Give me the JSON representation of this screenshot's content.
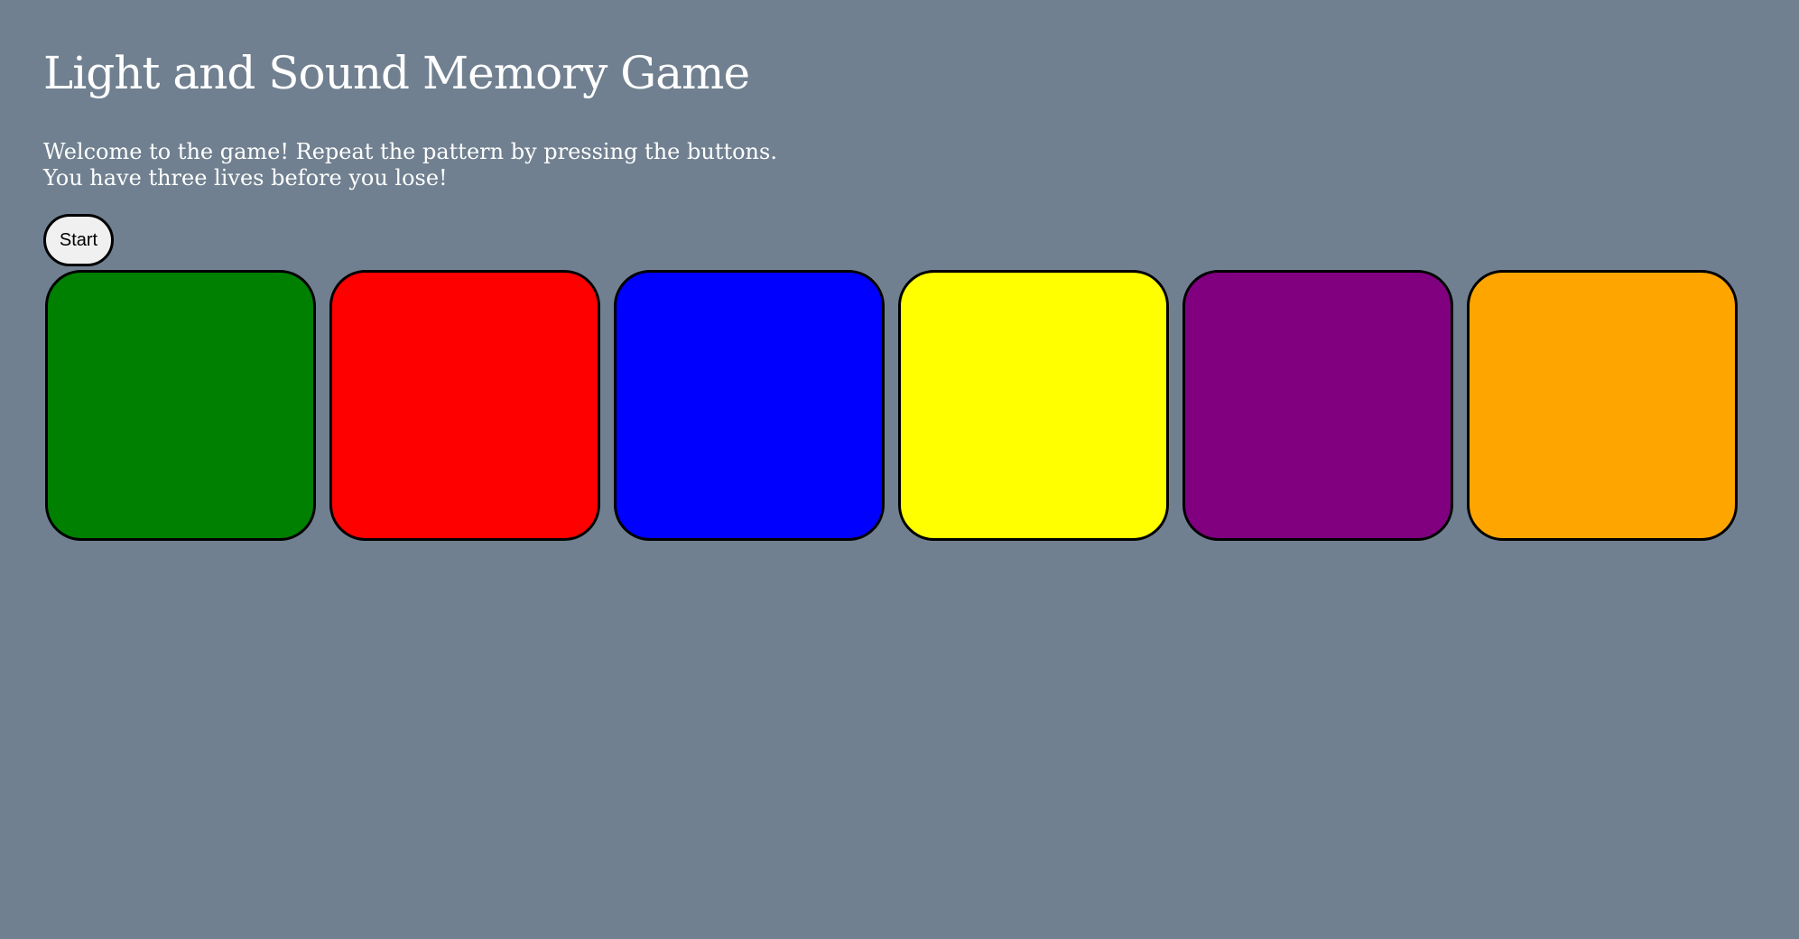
{
  "title": "Light and Sound Memory Game",
  "intro": {
    "line1": "Welcome to the game! Repeat the pattern by pressing the buttons.",
    "line2": "You have three lives before you lose!"
  },
  "start_label": "Start",
  "colors": {
    "background": "#708090",
    "buttons": [
      "#008000",
      "#ff0000",
      "#0000ff",
      "#ffff00",
      "#800080",
      "#ffa500"
    ]
  }
}
